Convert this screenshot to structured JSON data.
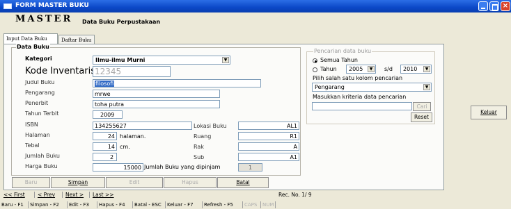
{
  "window": {
    "title": "FORM MASTER BUKU"
  },
  "header": {
    "title": "MASTER",
    "subtitle": "Data Buku Perpustakaan"
  },
  "tabs": [
    {
      "label": "Input Data Buku"
    },
    {
      "label": "Daftar Buku"
    }
  ],
  "form": {
    "group_label": "Data Buku",
    "kategori": {
      "label": "Kategori",
      "value": "Ilmu-ilmu Murni"
    },
    "kode": {
      "label": "Kode Inventaris",
      "value": "12345"
    },
    "judul": {
      "label": "Judul Buku",
      "value": "filosofi"
    },
    "pengarang": {
      "label": "Pengarang",
      "value": "mrwe"
    },
    "penerbit": {
      "label": "Penerbit",
      "value": "toha putra"
    },
    "tahun": {
      "label": "Tahun Terbit",
      "value": "2009"
    },
    "isbn": {
      "label": "ISBN",
      "value": "134255627"
    },
    "halaman": {
      "label": "Halaman",
      "value": "24",
      "unit": "halaman."
    },
    "tebal": {
      "label": "Tebal",
      "value": "14",
      "unit": "cm."
    },
    "jumlah": {
      "label": "Jumlah Buku",
      "value": "2"
    },
    "harga": {
      "label": "Harga Buku",
      "value": "15000"
    },
    "dipinjam": {
      "label": "Jumlah Buku yang dipinjam",
      "value": "1"
    },
    "lokasi": {
      "label": "Lokasi Buku",
      "value": "AL1"
    },
    "ruang": {
      "label": "Ruang",
      "value": "R1"
    },
    "rak": {
      "label": "Rak",
      "value": "A"
    },
    "sub": {
      "label": "Sub",
      "value": "A1"
    }
  },
  "buttons": {
    "baru": "Baru",
    "simpan": "Simpan",
    "edit": "Edit",
    "hapus": "Hapus",
    "batal": "Batal",
    "keluar": "Keluar"
  },
  "search": {
    "group_label": "Pencarian data buku",
    "opt_all": "Semua Tahun",
    "opt_year": "Tahun",
    "year_from": "2005",
    "sd": "s/d",
    "year_to": "2010",
    "column_prompt": "Pilih salah satu kolom pencarian",
    "column_value": "Pengarang",
    "criteria_prompt": "Masukkan kriteria data pencarian",
    "criteria_value": "",
    "cari": "Cari",
    "reset": "Reset"
  },
  "nav": {
    "first": "<< First",
    "prev": "< Prev",
    "next": "Next >",
    "last": "Last >>",
    "record": "Rec. No. 1/ 9"
  },
  "status": [
    "Baru - F1",
    "Simpan - F2",
    "Edit - F3",
    "Hapus - F4",
    "Batal - ESC",
    "Keluar - F7",
    "Refresh - F5",
    "CAPS",
    "NUM"
  ]
}
